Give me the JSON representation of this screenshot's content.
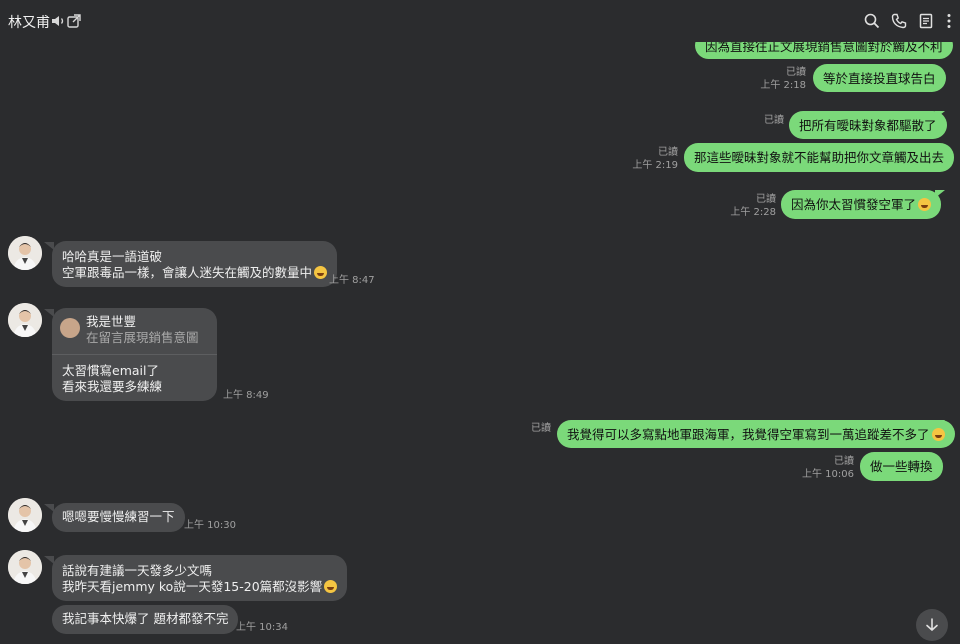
{
  "header": {
    "contact_name": "林又甫",
    "icons": [
      "mute-icon",
      "external-window-icon",
      "search-icon",
      "phone-icon",
      "notes-icon",
      "more-icon"
    ]
  },
  "colors": {
    "background": "#2b2c2e",
    "outgoing": "#7bd97a",
    "incoming": "#4a4b4d",
    "meta": "#a0a0a0"
  },
  "messages": {
    "m0": {
      "text": "因為直接往正文展現銷售意圖對於觸及不利"
    },
    "m1": {
      "text": "等於直接投直球告白",
      "read": "已讀",
      "time": "上午 2:18"
    },
    "m2": {
      "text": "把所有曖昧對象都驅散了",
      "read": "已讀"
    },
    "m3": {
      "text": "那這些曖昧對象就不能幫助把你文章觸及出去",
      "read": "已讀",
      "time": "上午 2:19"
    },
    "m4": {
      "text": "因為你太習慣發空軍了",
      "read": "已讀",
      "time": "上午 2:28"
    },
    "m5": {
      "line1": "哈哈真是一語道破",
      "line2": "空軍跟毒品一樣，會讓人迷失在觸及的數量中",
      "time": "上午 8:47"
    },
    "m6": {
      "reply_name": "我是世豐",
      "reply_text": "在留言展現銷售意圖",
      "line1": "太習慣寫email了",
      "line2": "看來我還要多練練",
      "time": "上午 8:49"
    },
    "m7": {
      "text": "我覺得可以多寫點地軍跟海軍，我覺得空軍寫到一萬追蹤差不多了",
      "read": "已讀"
    },
    "m8": {
      "text": "做一些轉換",
      "read": "已讀",
      "time": "上午 10:06"
    },
    "m9": {
      "text": "嗯嗯要慢慢練習一下",
      "time": "上午 10:30"
    },
    "m10": {
      "line1": "話說有建議一天發多少文嗎",
      "line2": "我昨天看jemmy ko說一天發15-20篇都沒影響"
    },
    "m11": {
      "text": "我記事本快爆了 題材都發不完",
      "time": "上午 10:34"
    }
  }
}
